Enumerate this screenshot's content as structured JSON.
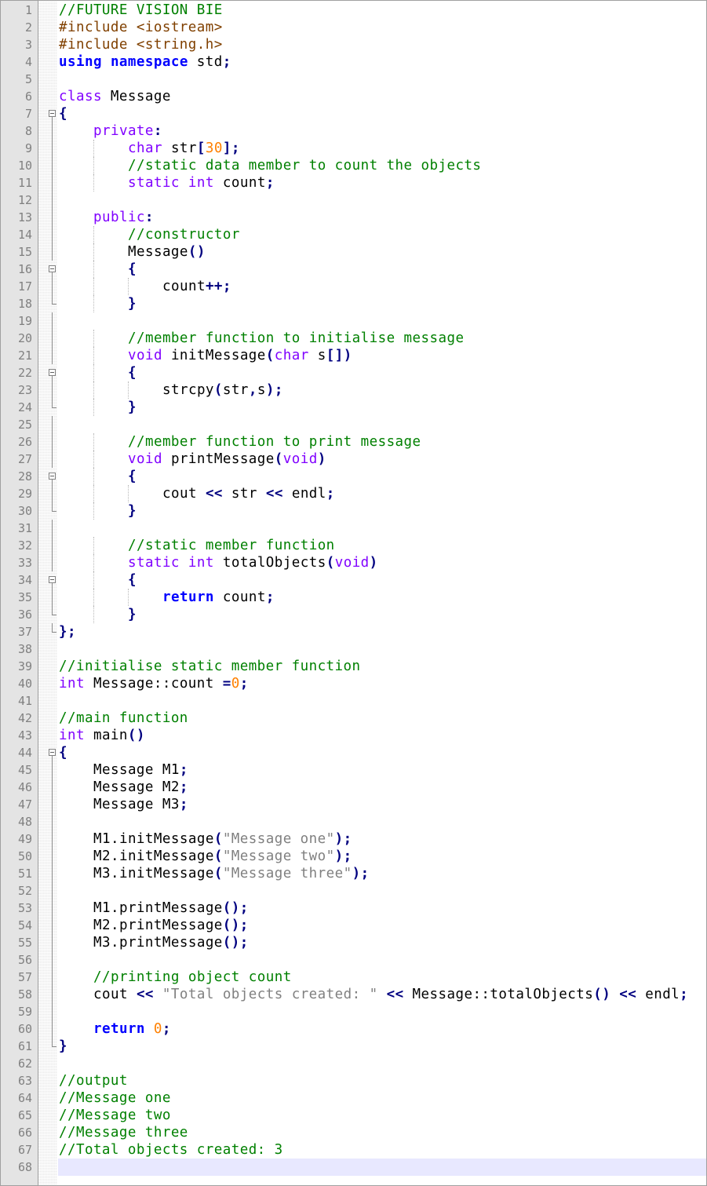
{
  "editor": {
    "language": "C++",
    "current_line": 68,
    "colors": {
      "gutter_bg": "#e4e4e4",
      "line_number": "#808080",
      "comment": "#008000",
      "preprocessor": "#804000",
      "keyword": "#0000ff",
      "type": "#8000ff",
      "operator": "#000080",
      "number": "#ff8000",
      "string": "#808080",
      "current_line_bg": "#e8e8ff"
    },
    "lines": [
      {
        "n": "1",
        "indent": 0,
        "fold": "",
        "tokens": [
          {
            "t": "comment",
            "v": "//FUTURE VISION BIE"
          }
        ]
      },
      {
        "n": "2",
        "indent": 0,
        "fold": "",
        "tokens": [
          {
            "t": "preproc",
            "v": "#include <iostream>"
          }
        ]
      },
      {
        "n": "3",
        "indent": 0,
        "fold": "",
        "tokens": [
          {
            "t": "preproc",
            "v": "#include <string.h>"
          }
        ]
      },
      {
        "n": "4",
        "indent": 0,
        "fold": "",
        "tokens": [
          {
            "t": "keyword",
            "v": "using"
          },
          {
            "t": "plain",
            "v": " "
          },
          {
            "t": "keyword",
            "v": "namespace"
          },
          {
            "t": "plain",
            "v": " std"
          },
          {
            "t": "operator",
            "v": ";"
          }
        ]
      },
      {
        "n": "5",
        "indent": 0,
        "fold": "",
        "tokens": []
      },
      {
        "n": "6",
        "indent": 0,
        "fold": "",
        "tokens": [
          {
            "t": "type",
            "v": "class"
          },
          {
            "t": "plain",
            "v": " Message"
          }
        ]
      },
      {
        "n": "7",
        "indent": 0,
        "fold": "open",
        "tokens": [
          {
            "t": "operator",
            "v": "{"
          }
        ]
      },
      {
        "n": "8",
        "indent": 1,
        "fold": "line",
        "tokens": [
          {
            "t": "access",
            "v": "private"
          },
          {
            "t": "operator",
            "v": ":"
          }
        ]
      },
      {
        "n": "9",
        "indent": 2,
        "fold": "line",
        "tokens": [
          {
            "t": "type",
            "v": "char"
          },
          {
            "t": "plain",
            "v": " str"
          },
          {
            "t": "operator",
            "v": "["
          },
          {
            "t": "number",
            "v": "30"
          },
          {
            "t": "operator",
            "v": "];"
          }
        ]
      },
      {
        "n": "10",
        "indent": 2,
        "fold": "line",
        "tokens": [
          {
            "t": "comment",
            "v": "//static data member to count the objects"
          }
        ]
      },
      {
        "n": "11",
        "indent": 2,
        "fold": "line",
        "tokens": [
          {
            "t": "type",
            "v": "static"
          },
          {
            "t": "plain",
            "v": " "
          },
          {
            "t": "type",
            "v": "int"
          },
          {
            "t": "plain",
            "v": " count"
          },
          {
            "t": "operator",
            "v": ";"
          }
        ]
      },
      {
        "n": "12",
        "indent": 0,
        "fold": "line",
        "tokens": []
      },
      {
        "n": "13",
        "indent": 1,
        "fold": "line",
        "tokens": [
          {
            "t": "access",
            "v": "public"
          },
          {
            "t": "operator",
            "v": ":"
          }
        ]
      },
      {
        "n": "14",
        "indent": 2,
        "fold": "line",
        "tokens": [
          {
            "t": "comment",
            "v": "//constructor"
          }
        ]
      },
      {
        "n": "15",
        "indent": 2,
        "fold": "line",
        "tokens": [
          {
            "t": "plain",
            "v": "Message"
          },
          {
            "t": "operator",
            "v": "()"
          }
        ]
      },
      {
        "n": "16",
        "indent": 2,
        "fold": "open",
        "tokens": [
          {
            "t": "operator",
            "v": "{"
          }
        ]
      },
      {
        "n": "17",
        "indent": 3,
        "fold": "line",
        "tokens": [
          {
            "t": "plain",
            "v": "count"
          },
          {
            "t": "operator",
            "v": "++;"
          }
        ]
      },
      {
        "n": "18",
        "indent": 2,
        "fold": "end",
        "tokens": [
          {
            "t": "operator",
            "v": "}"
          }
        ]
      },
      {
        "n": "19",
        "indent": 0,
        "fold": "line",
        "tokens": []
      },
      {
        "n": "20",
        "indent": 2,
        "fold": "line",
        "tokens": [
          {
            "t": "comment",
            "v": "//member function to initialise message"
          }
        ]
      },
      {
        "n": "21",
        "indent": 2,
        "fold": "line",
        "tokens": [
          {
            "t": "type",
            "v": "void"
          },
          {
            "t": "plain",
            "v": " initMessage"
          },
          {
            "t": "operator",
            "v": "("
          },
          {
            "t": "type",
            "v": "char"
          },
          {
            "t": "plain",
            "v": " s"
          },
          {
            "t": "operator",
            "v": "[])"
          }
        ]
      },
      {
        "n": "22",
        "indent": 2,
        "fold": "open",
        "tokens": [
          {
            "t": "operator",
            "v": "{"
          }
        ]
      },
      {
        "n": "23",
        "indent": 3,
        "fold": "line",
        "tokens": [
          {
            "t": "plain",
            "v": "strcpy"
          },
          {
            "t": "operator",
            "v": "("
          },
          {
            "t": "plain",
            "v": "str"
          },
          {
            "t": "operator",
            "v": ","
          },
          {
            "t": "plain",
            "v": "s"
          },
          {
            "t": "operator",
            "v": ");"
          }
        ]
      },
      {
        "n": "24",
        "indent": 2,
        "fold": "end",
        "tokens": [
          {
            "t": "operator",
            "v": "}"
          }
        ]
      },
      {
        "n": "25",
        "indent": 0,
        "fold": "line",
        "tokens": []
      },
      {
        "n": "26",
        "indent": 2,
        "fold": "line",
        "tokens": [
          {
            "t": "comment",
            "v": "//member function to print message"
          }
        ]
      },
      {
        "n": "27",
        "indent": 2,
        "fold": "line",
        "tokens": [
          {
            "t": "type",
            "v": "void"
          },
          {
            "t": "plain",
            "v": " printMessage"
          },
          {
            "t": "operator",
            "v": "("
          },
          {
            "t": "type",
            "v": "void"
          },
          {
            "t": "operator",
            "v": ")"
          }
        ]
      },
      {
        "n": "28",
        "indent": 2,
        "fold": "open",
        "tokens": [
          {
            "t": "operator",
            "v": "{"
          }
        ]
      },
      {
        "n": "29",
        "indent": 3,
        "fold": "line",
        "tokens": [
          {
            "t": "plain",
            "v": "cout "
          },
          {
            "t": "operator",
            "v": "<<"
          },
          {
            "t": "plain",
            "v": " str "
          },
          {
            "t": "operator",
            "v": "<<"
          },
          {
            "t": "plain",
            "v": " endl"
          },
          {
            "t": "operator",
            "v": ";"
          }
        ]
      },
      {
        "n": "30",
        "indent": 2,
        "fold": "end",
        "tokens": [
          {
            "t": "operator",
            "v": "}"
          }
        ]
      },
      {
        "n": "31",
        "indent": 0,
        "fold": "line",
        "tokens": []
      },
      {
        "n": "32",
        "indent": 2,
        "fold": "line",
        "tokens": [
          {
            "t": "comment",
            "v": "//static member function"
          }
        ]
      },
      {
        "n": "33",
        "indent": 2,
        "fold": "line",
        "tokens": [
          {
            "t": "type",
            "v": "static"
          },
          {
            "t": "plain",
            "v": " "
          },
          {
            "t": "type",
            "v": "int"
          },
          {
            "t": "plain",
            "v": " totalObjects"
          },
          {
            "t": "operator",
            "v": "("
          },
          {
            "t": "type",
            "v": "void"
          },
          {
            "t": "operator",
            "v": ")"
          }
        ]
      },
      {
        "n": "34",
        "indent": 2,
        "fold": "open",
        "tokens": [
          {
            "t": "operator",
            "v": "{"
          }
        ]
      },
      {
        "n": "35",
        "indent": 3,
        "fold": "line",
        "tokens": [
          {
            "t": "keyword",
            "v": "return"
          },
          {
            "t": "plain",
            "v": " count"
          },
          {
            "t": "operator",
            "v": ";"
          }
        ]
      },
      {
        "n": "36",
        "indent": 2,
        "fold": "end",
        "tokens": [
          {
            "t": "operator",
            "v": "}"
          }
        ]
      },
      {
        "n": "37",
        "indent": 0,
        "fold": "end",
        "tokens": [
          {
            "t": "operator",
            "v": "};"
          }
        ]
      },
      {
        "n": "38",
        "indent": 0,
        "fold": "",
        "tokens": []
      },
      {
        "n": "39",
        "indent": 0,
        "fold": "",
        "tokens": [
          {
            "t": "comment",
            "v": "//initialise static member function"
          }
        ]
      },
      {
        "n": "40",
        "indent": 0,
        "fold": "",
        "tokens": [
          {
            "t": "type",
            "v": "int"
          },
          {
            "t": "plain",
            "v": " Message::count "
          },
          {
            "t": "operator",
            "v": "="
          },
          {
            "t": "number",
            "v": "0"
          },
          {
            "t": "operator",
            "v": ";"
          }
        ]
      },
      {
        "n": "41",
        "indent": 0,
        "fold": "",
        "tokens": []
      },
      {
        "n": "42",
        "indent": 0,
        "fold": "",
        "tokens": [
          {
            "t": "comment",
            "v": "//main function"
          }
        ]
      },
      {
        "n": "43",
        "indent": 0,
        "fold": "",
        "tokens": [
          {
            "t": "type",
            "v": "int"
          },
          {
            "t": "plain",
            "v": " main"
          },
          {
            "t": "operator",
            "v": "()"
          }
        ]
      },
      {
        "n": "44",
        "indent": 0,
        "fold": "open",
        "tokens": [
          {
            "t": "operator",
            "v": "{"
          }
        ]
      },
      {
        "n": "45",
        "indent": 1,
        "fold": "line",
        "tokens": [
          {
            "t": "plain",
            "v": "Message M1"
          },
          {
            "t": "operator",
            "v": ";"
          }
        ]
      },
      {
        "n": "46",
        "indent": 1,
        "fold": "line",
        "tokens": [
          {
            "t": "plain",
            "v": "Message M2"
          },
          {
            "t": "operator",
            "v": ";"
          }
        ]
      },
      {
        "n": "47",
        "indent": 1,
        "fold": "line",
        "tokens": [
          {
            "t": "plain",
            "v": "Message M3"
          },
          {
            "t": "operator",
            "v": ";"
          }
        ]
      },
      {
        "n": "48",
        "indent": 0,
        "fold": "line",
        "tokens": []
      },
      {
        "n": "49",
        "indent": 1,
        "fold": "line",
        "tokens": [
          {
            "t": "plain",
            "v": "M1.initMessage"
          },
          {
            "t": "operator",
            "v": "("
          },
          {
            "t": "string",
            "v": "\"Message one\""
          },
          {
            "t": "operator",
            "v": ");"
          }
        ]
      },
      {
        "n": "50",
        "indent": 1,
        "fold": "line",
        "tokens": [
          {
            "t": "plain",
            "v": "M2.initMessage"
          },
          {
            "t": "operator",
            "v": "("
          },
          {
            "t": "string",
            "v": "\"Message two\""
          },
          {
            "t": "operator",
            "v": ");"
          }
        ]
      },
      {
        "n": "51",
        "indent": 1,
        "fold": "line",
        "tokens": [
          {
            "t": "plain",
            "v": "M3.initMessage"
          },
          {
            "t": "operator",
            "v": "("
          },
          {
            "t": "string",
            "v": "\"Message three\""
          },
          {
            "t": "operator",
            "v": ");"
          }
        ]
      },
      {
        "n": "52",
        "indent": 0,
        "fold": "line",
        "tokens": []
      },
      {
        "n": "53",
        "indent": 1,
        "fold": "line",
        "tokens": [
          {
            "t": "plain",
            "v": "M1.printMessage"
          },
          {
            "t": "operator",
            "v": "();"
          }
        ]
      },
      {
        "n": "54",
        "indent": 1,
        "fold": "line",
        "tokens": [
          {
            "t": "plain",
            "v": "M2.printMessage"
          },
          {
            "t": "operator",
            "v": "();"
          }
        ]
      },
      {
        "n": "55",
        "indent": 1,
        "fold": "line",
        "tokens": [
          {
            "t": "plain",
            "v": "M3.printMessage"
          },
          {
            "t": "operator",
            "v": "();"
          }
        ]
      },
      {
        "n": "56",
        "indent": 0,
        "fold": "line",
        "tokens": []
      },
      {
        "n": "57",
        "indent": 1,
        "fold": "line",
        "tokens": [
          {
            "t": "comment",
            "v": "//printing object count"
          }
        ]
      },
      {
        "n": "58",
        "indent": 1,
        "fold": "line",
        "tokens": [
          {
            "t": "plain",
            "v": "cout "
          },
          {
            "t": "operator",
            "v": "<<"
          },
          {
            "t": "plain",
            "v": " "
          },
          {
            "t": "string",
            "v": "\"Total objects created: \""
          },
          {
            "t": "plain",
            "v": " "
          },
          {
            "t": "operator",
            "v": "<<"
          },
          {
            "t": "plain",
            "v": " Message::totalObjects"
          },
          {
            "t": "operator",
            "v": "()"
          },
          {
            "t": "plain",
            "v": " "
          },
          {
            "t": "operator",
            "v": "<<"
          },
          {
            "t": "plain",
            "v": " endl"
          },
          {
            "t": "operator",
            "v": ";"
          }
        ]
      },
      {
        "n": "59",
        "indent": 0,
        "fold": "line",
        "tokens": []
      },
      {
        "n": "60",
        "indent": 1,
        "fold": "line",
        "tokens": [
          {
            "t": "keyword",
            "v": "return"
          },
          {
            "t": "plain",
            "v": " "
          },
          {
            "t": "number",
            "v": "0"
          },
          {
            "t": "operator",
            "v": ";"
          }
        ]
      },
      {
        "n": "61",
        "indent": 0,
        "fold": "end",
        "tokens": [
          {
            "t": "operator",
            "v": "}"
          }
        ]
      },
      {
        "n": "62",
        "indent": 0,
        "fold": "",
        "tokens": []
      },
      {
        "n": "63",
        "indent": 0,
        "fold": "",
        "tokens": [
          {
            "t": "comment",
            "v": "//output"
          }
        ]
      },
      {
        "n": "64",
        "indent": 0,
        "fold": "",
        "tokens": [
          {
            "t": "comment",
            "v": "//Message one"
          }
        ]
      },
      {
        "n": "65",
        "indent": 0,
        "fold": "",
        "tokens": [
          {
            "t": "comment",
            "v": "//Message two"
          }
        ]
      },
      {
        "n": "66",
        "indent": 0,
        "fold": "",
        "tokens": [
          {
            "t": "comment",
            "v": "//Message three"
          }
        ]
      },
      {
        "n": "67",
        "indent": 0,
        "fold": "",
        "tokens": [
          {
            "t": "comment",
            "v": "//Total objects created: 3"
          }
        ]
      },
      {
        "n": "68",
        "indent": 0,
        "fold": "",
        "tokens": []
      }
    ]
  }
}
